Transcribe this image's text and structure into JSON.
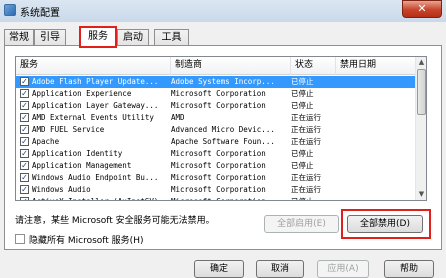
{
  "window": {
    "title": "系统配置",
    "close": "✕"
  },
  "tabs": [
    {
      "label": "常规"
    },
    {
      "label": "引导"
    },
    {
      "label": "服务"
    },
    {
      "label": "启动"
    },
    {
      "label": "工具"
    }
  ],
  "columns": [
    "服务",
    "制造商",
    "状态",
    "禁用日期"
  ],
  "rows": [
    {
      "checked": true,
      "service": "Adobe Flash Player Update...",
      "manufacturer": "Adobe Systems Incorp...",
      "status": "已停止",
      "selected": true
    },
    {
      "checked": true,
      "service": "Application Experience",
      "manufacturer": "Microsoft Corporation",
      "status": "已停止"
    },
    {
      "checked": true,
      "service": "Application Layer Gateway...",
      "manufacturer": "Microsoft Corporation",
      "status": "已停止"
    },
    {
      "checked": true,
      "service": "AMD External Events Utility",
      "manufacturer": "AMD",
      "status": "正在运行"
    },
    {
      "checked": true,
      "service": "AMD FUEL Service",
      "manufacturer": "Advanced Micro Devic...",
      "status": "正在运行"
    },
    {
      "checked": true,
      "service": "Apache",
      "manufacturer": "Apache Software Foun...",
      "status": "正在运行"
    },
    {
      "checked": true,
      "service": "Application Identity",
      "manufacturer": "Microsoft Corporation",
      "status": "已停止"
    },
    {
      "checked": true,
      "service": "Application Management",
      "manufacturer": "Microsoft Corporation",
      "status": "已停止"
    },
    {
      "checked": true,
      "service": "Windows Audio Endpoint Bu...",
      "manufacturer": "Microsoft Corporation",
      "status": "正在运行"
    },
    {
      "checked": true,
      "service": "Windows Audio",
      "manufacturer": "Microsoft Corporation",
      "status": "正在运行"
    },
    {
      "checked": true,
      "service": "ActiveX Installer (AxInstSV)",
      "manufacturer": "Microsoft Corporation",
      "status": "已停止"
    }
  ],
  "notice": "请注意，某些 Microsoft 安全服务可能无法禁用。",
  "enable_all": "全部启用(E)",
  "disable_all": "全部禁用(D)",
  "hide_ms": "隐藏所有 Microsoft 服务(H)",
  "footer": {
    "ok": "确定",
    "cancel": "取消",
    "apply": "应用(A)",
    "help": "帮助"
  }
}
